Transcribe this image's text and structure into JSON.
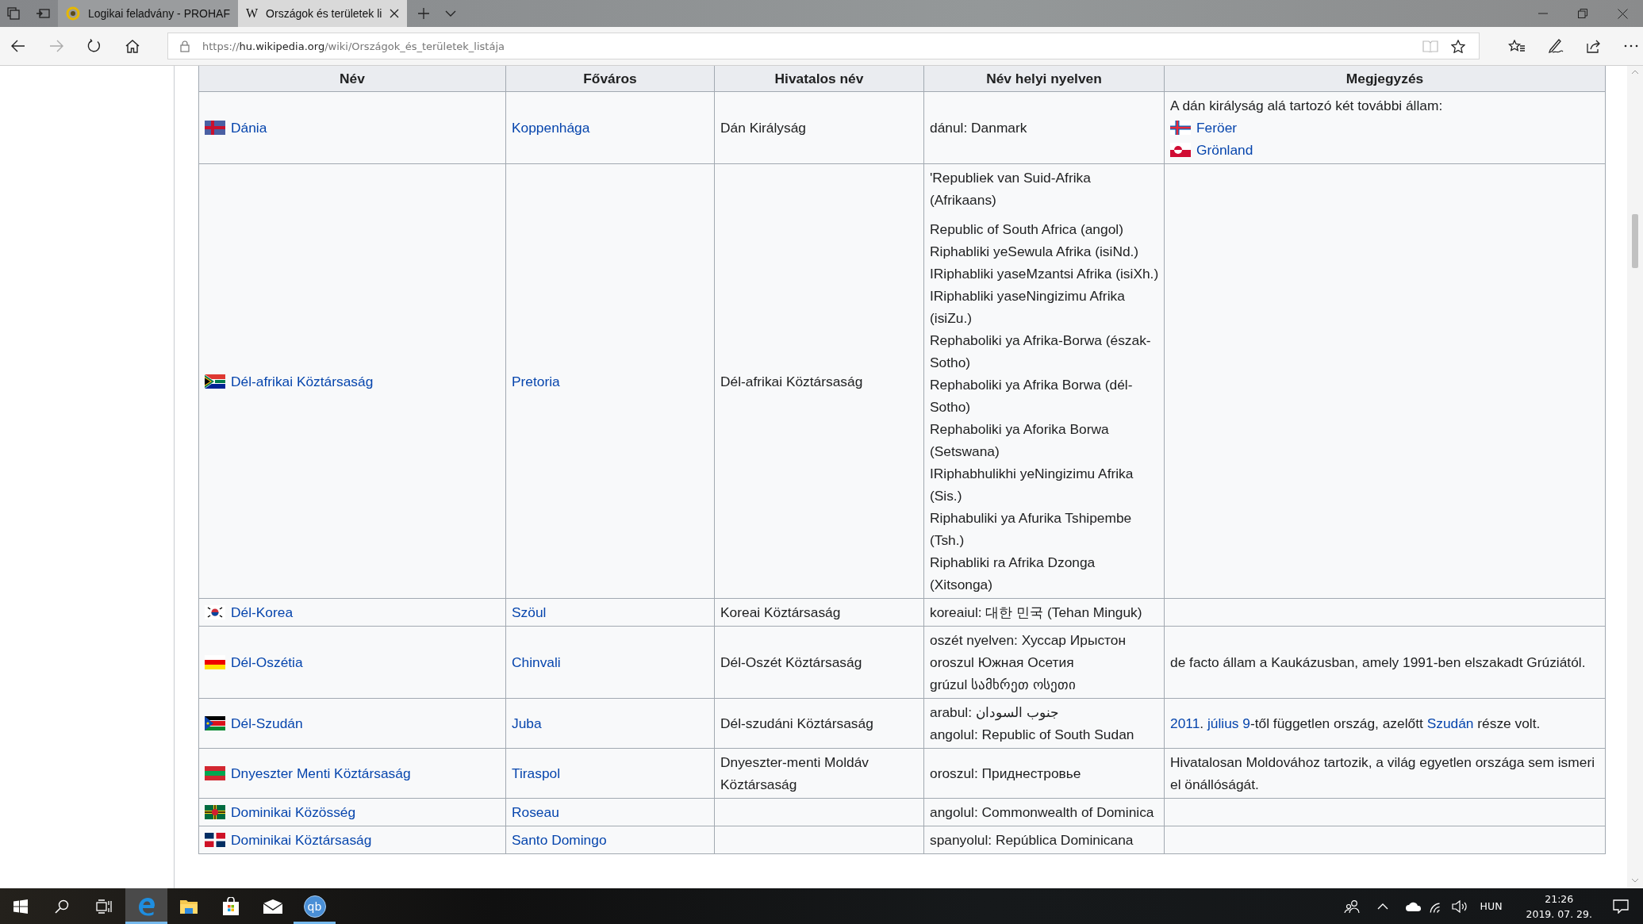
{
  "browser": {
    "tabs": [
      {
        "title": "Logikai feladvány - PROHAF",
        "selected": false,
        "favicon": {
          "kind": "ring"
        }
      },
      {
        "title": "Országok és területek li",
        "selected": true,
        "favicon": {
          "kind": "letter",
          "text": "W"
        }
      }
    ],
    "url": {
      "scheme": "https://",
      "host": "hu.wikipedia.org",
      "path": "/wiki/Országok_és_területek_listája"
    }
  },
  "table": {
    "columns": [
      "Név",
      "Főváros",
      "Hivatalos név",
      "Név helyi nyelven",
      "Megjegyzés"
    ],
    "rows": [
      {
        "flag": {
          "kind": "dk"
        },
        "name": "Dánia",
        "capital": "Koppenhága",
        "official": "Dán Királyság",
        "native": [
          [
            "dánul: Danmark"
          ]
        ],
        "note": {
          "sentence": [
            {
              "text": "A dán királyság alá tartozó két további állam:",
              "link": false
            }
          ],
          "links": [
            {
              "flag": {
                "kind": "fo"
              },
              "text": "Feröer"
            },
            {
              "flag": {
                "kind": "gl"
              },
              "text": "Grönland"
            }
          ]
        }
      },
      {
        "flag": {
          "kind": "za"
        },
        "name": "Dél-afrikai Köztársaság",
        "capital": "Pretoria",
        "official": "Dél-afrikai Köztársaság",
        "native": [
          [
            "'Republiek van Suid-Afrika (Afrikaans)"
          ],
          [
            "Republic of South Africa (angol)",
            "Riphabliki yeSewula Afrika (isiNd.)",
            "IRiphabliki yaseMzantsi Afrika (isiXh.)",
            "IRiphabliki yaseNingizimu Afrika (isiZu.)",
            "Rephaboliki ya Afrika-Borwa (észak-Sotho)",
            "Rephaboliki ya Afrika Borwa (dél-Sotho)",
            "Rephaboliki ya Aforika Borwa (Setswana)",
            "IRiphabhulikhi yeNingizimu Afrika (Sis.)",
            "Riphabuliki ya Afurika Tshipembe (Tsh.)",
            "Riphabliki ra Afrika Dzonga (Xitsonga)"
          ]
        ]
      },
      {
        "flag": {
          "kind": "kr"
        },
        "name": "Dél-Korea",
        "capital": "Szöul",
        "official": "Koreai Köztársaság",
        "native": [
          [
            "koreaiul: 대한 민국 (Tehan Minguk)"
          ]
        ]
      },
      {
        "flag": {
          "kind": "os"
        },
        "name": "Dél-Oszétia",
        "capital": "Chinvali",
        "official": "Dél-Oszét Köztársaság",
        "native": [
          [
            "oszét nyelven: Хуссар Ирыстон",
            "oroszul Южная Осетия",
            "grúzul სამხრეთ ოსეთი"
          ]
        ],
        "note": {
          "sentence": [
            {
              "text": "de facto állam a Kaukázusban, amely 1991-ben elszakadt Grúziától.",
              "link": false
            }
          ]
        }
      },
      {
        "flag": {
          "kind": "ss"
        },
        "name": "Dél-Szudán",
        "capital": "Juba",
        "official": "Dél-szudáni Köztársaság",
        "native": [
          [
            "arabul: جنوب السودان",
            "angolul: Republic of South Sudan"
          ]
        ],
        "note": {
          "sentence": [
            {
              "text": "2011",
              "link": true
            },
            {
              "text": ". ",
              "link": false
            },
            {
              "text": "július 9",
              "link": true
            },
            {
              "text": "-től független ország, azelőtt ",
              "link": false
            },
            {
              "text": "Szudán",
              "link": true
            },
            {
              "text": " része volt.",
              "link": false
            }
          ]
        }
      },
      {
        "flag": {
          "kind": "tn"
        },
        "name": "Dnyeszter Menti Köztársaság",
        "capital": "Tiraspol",
        "official": "Dnyeszter-menti Moldáv Köztársaság",
        "native": [
          [
            "oroszul: Приднестровье"
          ]
        ],
        "note": {
          "sentence": [
            {
              "text": "Hivatalosan Moldovához tartozik, a világ egyetlen országa sem ismeri el önállóságát.",
              "link": false
            }
          ]
        }
      },
      {
        "flag": {
          "kind": "dm"
        },
        "name": "Dominikai Közösség",
        "capital": "Roseau",
        "native": [
          [
            "angolul: Commonwealth of Dominica"
          ]
        ]
      },
      {
        "flag": {
          "kind": "do"
        },
        "name": "Dominikai Köztársaság",
        "capital": "Santo Domingo",
        "native": [
          [
            "spanyolul: República Dominicana"
          ]
        ]
      }
    ]
  },
  "taskbar": {
    "apps": [
      {
        "kind": "edge",
        "active": true,
        "running": true
      },
      {
        "kind": "explorer",
        "active": false,
        "running": false
      },
      {
        "kind": "store",
        "active": false,
        "running": false
      },
      {
        "kind": "mail",
        "active": false,
        "running": false
      },
      {
        "kind": "qbittorrent",
        "label": "qb",
        "active": false,
        "running": true
      }
    ],
    "language": "HUN",
    "time": "21:26",
    "date": "2019. 07. 29."
  }
}
